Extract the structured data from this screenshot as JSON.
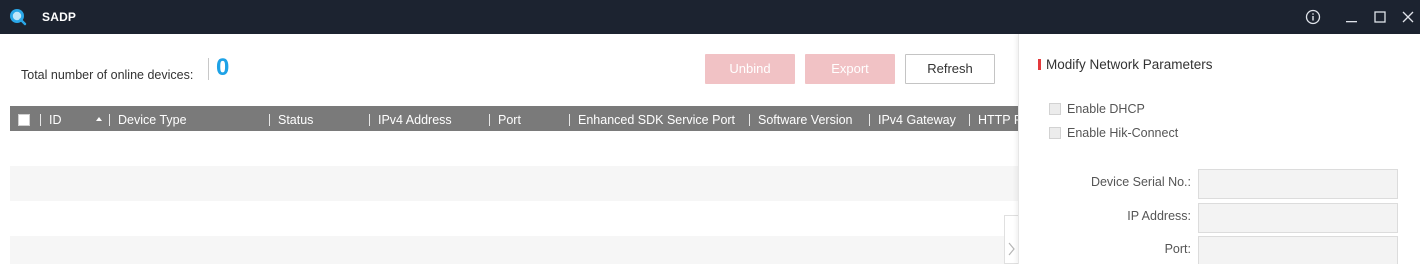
{
  "titlebar": {
    "app_title": "SADP",
    "icons": [
      "app-logo-icon",
      "info-icon",
      "minimize-icon",
      "maximize-icon",
      "close-icon"
    ]
  },
  "summary": {
    "total_label": "Total number of online devices:",
    "total_count": "0"
  },
  "toolbar": {
    "unbind_label": "Unbind",
    "export_label": "Export",
    "refresh_label": "Refresh"
  },
  "table": {
    "columns": [
      "ID",
      "Device Type",
      "Status",
      "IPv4 Address",
      "Port",
      "Enhanced SDK Service Port",
      "Software Version",
      "IPv4 Gateway",
      "HTTP Port"
    ],
    "rows": []
  },
  "panel": {
    "title": "Modify Network Parameters",
    "enable_dhcp_label": "Enable DHCP",
    "enable_hik_connect_label": "Enable Hik-Connect",
    "fields": {
      "serial_label": "Device Serial No.:",
      "serial_value": "",
      "ip_label": "IP Address:",
      "ip_value": "",
      "port_label": "Port:",
      "port_value": ""
    }
  },
  "colors": {
    "titlebar_bg": "#1c2330",
    "accent_blue": "#1ea2e6",
    "accent_red": "#e4393c",
    "disabled_button": "#f1c2c5",
    "table_header_bg": "#7a7a7a"
  }
}
